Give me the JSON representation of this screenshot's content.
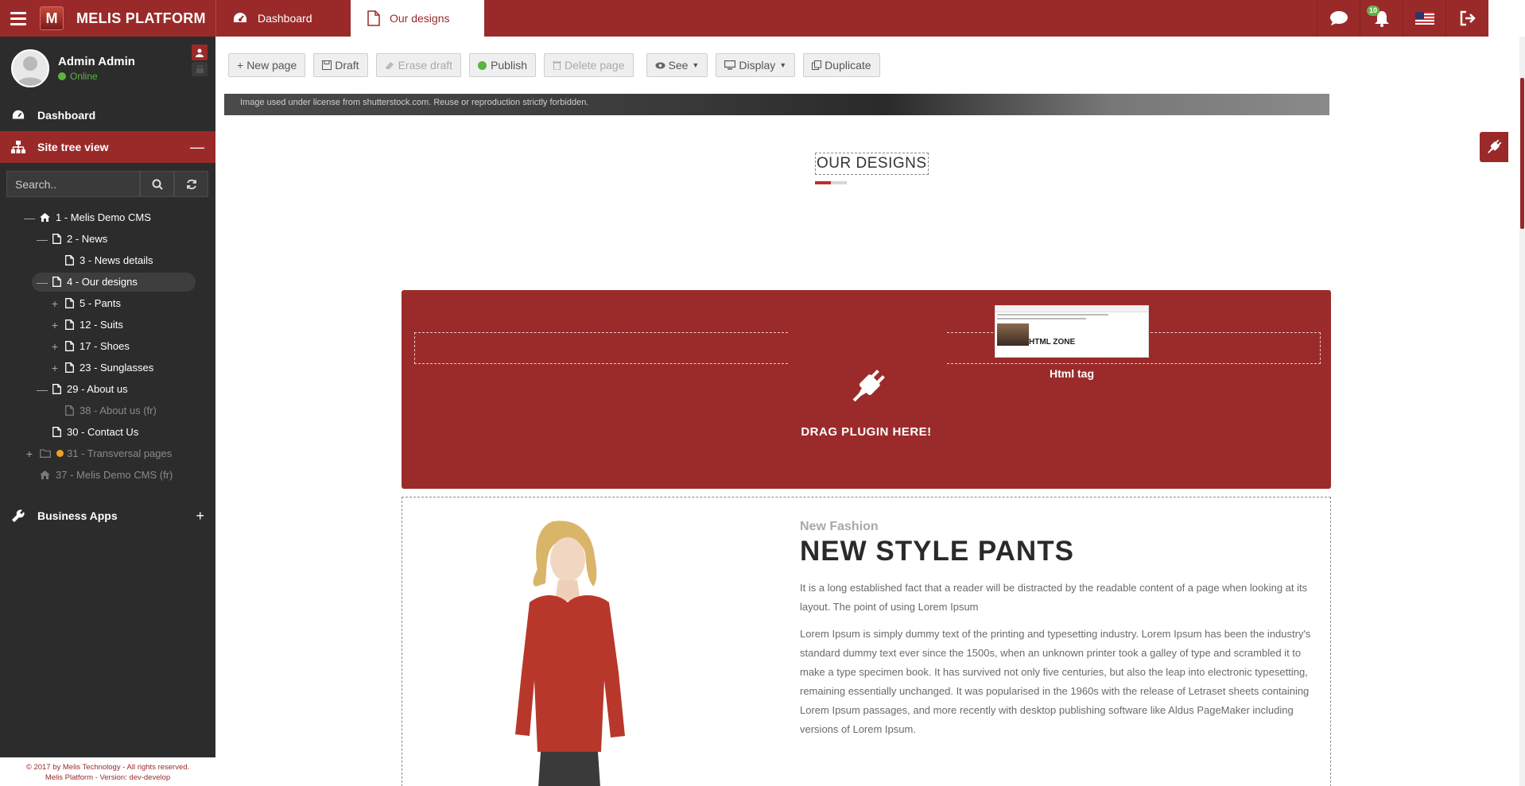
{
  "app": {
    "brand_logo": "M",
    "brand_name": "MELIS PLATFORM"
  },
  "tabs": [
    {
      "label": "Dashboard",
      "icon": "dashboard-icon"
    },
    {
      "label": "Our designs",
      "icon": "page-icon",
      "active": true
    }
  ],
  "topbar_right": {
    "notification_count": "10",
    "icons": [
      "chat-icon",
      "bell-icon",
      "us-flag-icon",
      "logout-icon"
    ]
  },
  "sidebar": {
    "user_name": "Admin Admin",
    "user_status": "Online",
    "menu": [
      {
        "label": "Dashboard",
        "icon": "dashboard-icon"
      },
      {
        "label": "Site tree view",
        "icon": "sitemap-icon",
        "toggle": "—"
      }
    ],
    "search_placeholder": "Search..",
    "tree": [
      {
        "label": "1 - Melis Demo CMS",
        "toggle": "—",
        "icon": "home-icon"
      },
      {
        "label": "2 - News",
        "toggle": "—",
        "icon": "page-icon"
      },
      {
        "label": "3 - News details",
        "toggle": "",
        "icon": "page-icon"
      },
      {
        "label": "4 - Our designs",
        "toggle": "—",
        "icon": "page-icon",
        "selected": true
      },
      {
        "label": "5 - Pants",
        "toggle": "+",
        "icon": "page-icon"
      },
      {
        "label": "12 - Suits",
        "toggle": "+",
        "icon": "page-icon"
      },
      {
        "label": "17 - Shoes",
        "toggle": "+",
        "icon": "page-icon"
      },
      {
        "label": "23 - Sunglasses",
        "toggle": "+",
        "icon": "page-icon"
      },
      {
        "label": "29 - About us",
        "toggle": "—",
        "icon": "page-icon"
      },
      {
        "label": "38 - About us (fr)",
        "toggle": "",
        "icon": "page-icon",
        "dim": true
      },
      {
        "label": "30 - Contact Us",
        "toggle": "",
        "icon": "page-icon"
      },
      {
        "label": "31 - Transversal pages",
        "toggle": "+",
        "icon": "folder-icon",
        "dim": true,
        "status_dot": "#f0a020"
      },
      {
        "label": "37 - Melis Demo CMS (fr)",
        "toggle": "",
        "icon": "home-icon",
        "dim": true
      }
    ],
    "business_apps": {
      "label": "Business Apps",
      "toggle": "+"
    },
    "footer_line1": "© 2017 by Melis Technology - All rights reserved.",
    "footer_line2": "Melis Platform - Version: dev-develop"
  },
  "toolbar": {
    "new_page": "New page",
    "draft": "Draft",
    "erase_draft": "Erase draft",
    "publish": "Publish",
    "delete_page": "Delete page",
    "see": "See",
    "display": "Display",
    "duplicate": "Duplicate"
  },
  "preview": {
    "hero_credit": "Image used under license from shutterstock.com. Reuse or reproduction strictly forbidden.",
    "section_heading": "OUR DESIGNS",
    "drag_text": "DRAG PLUGIN HERE!",
    "html_zone_label": "HTML ZONE",
    "html_tag_label": "Html tag",
    "content": {
      "subtitle": "New Fashion",
      "title": "NEW STYLE PANTS",
      "paragraph1": "It is a long established fact that a reader will be distracted by the readable content of a page when looking at its layout. The point of using Lorem Ipsum",
      "paragraph2": "Lorem Ipsum is simply dummy text of the printing and typesetting industry. Lorem Ipsum has been the industry's standard dummy text ever since the 1500s, when an unknown printer took a galley of type and scrambled it to make a type specimen book. It has survived not only five centuries, but also the leap into electronic typesetting, remaining essentially unchanged. It was popularised in the 1960s with the release of Letraset sheets containing Lorem Ipsum passages, and more recently with desktop publishing software like Aldus PageMaker including versions of Lorem Ipsum."
    }
  },
  "colors": {
    "brand_red": "#9a2a2a",
    "sidebar_bg": "#2c2c2c",
    "online_green": "#5db341"
  }
}
